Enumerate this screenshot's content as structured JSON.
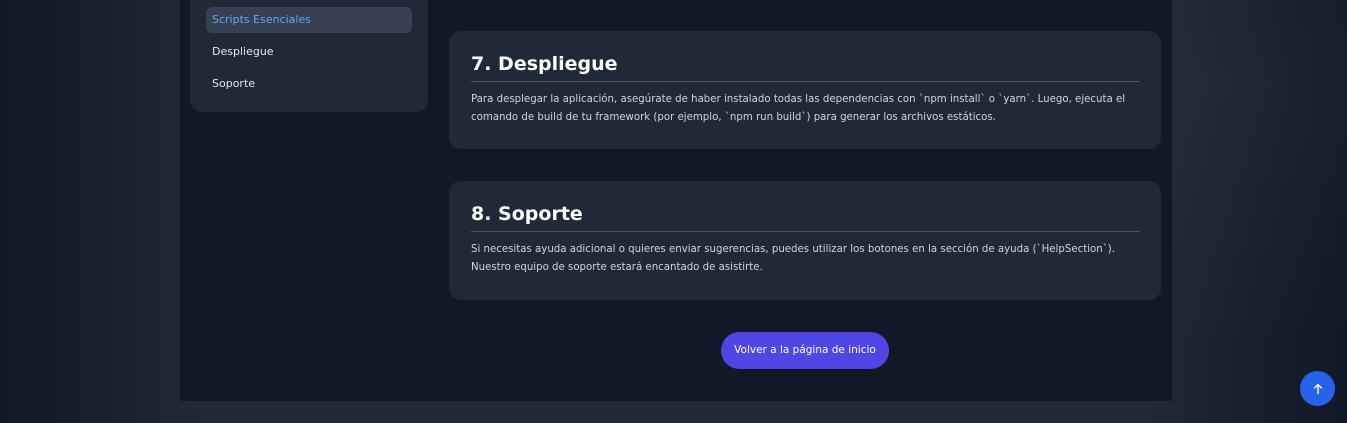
{
  "sidebar": {
    "items": [
      {
        "label": "Scripts Esenciales",
        "active": true
      },
      {
        "label": "Despliegue",
        "active": false
      },
      {
        "label": "Soporte",
        "active": false
      }
    ]
  },
  "sections": [
    {
      "title": "7. Despliegue",
      "body": "Para desplegar la aplicación, asegúrate de haber instalado todas las dependencias con `npm install` o `yarn`. Luego, ejecuta el comando de build de tu framework (por ejemplo, `npm run build`) para generar los archivos estáticos."
    },
    {
      "title": "8. Soporte",
      "body": "Si necesitas ayuda adicional o quieres enviar sugerencias, puedes utilizar los botones en la sección de ayuda (`HelpSection`). Nuestro equipo de soporte estará encantado de asistirte."
    }
  ],
  "home_button": {
    "label": "Volver a la página de inicio"
  },
  "scroll_top": {
    "icon": "arrow-up-icon"
  },
  "colors": {
    "accent": "#4f46e5",
    "scroll_button": "#2563eb",
    "active_link": "#60a5fa",
    "card_background": "#1f2937",
    "page_background": "#111827"
  }
}
